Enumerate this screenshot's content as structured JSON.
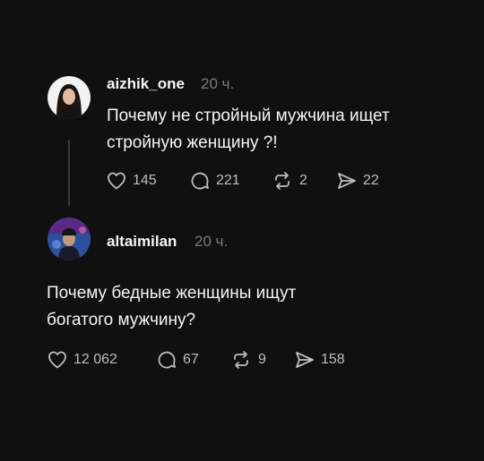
{
  "posts": [
    {
      "username": "aizhik_one",
      "time": "20 ч.",
      "text_lines": [
        "Почему не стройный мужчина ищет",
        "стройную женщину ?!"
      ],
      "actions": {
        "likes": "145",
        "comments": "221",
        "reposts": "2",
        "shares": "22"
      }
    },
    {
      "username": "altaimilan",
      "time": "20 ч.",
      "text_lines": [
        "Почему бедные женщины ищут",
        "богатого мужчину?"
      ],
      "actions": {
        "likes": "12 062",
        "comments": "67",
        "reposts": "9",
        "shares": "158"
      }
    }
  ],
  "icons": {
    "like": "heart-icon",
    "comment": "comment-icon",
    "repost": "repost-icon",
    "share": "share-icon"
  },
  "colors": {
    "background": "#101010",
    "text": "#f3f5f7",
    "muted": "#7a7a7a",
    "thread_line": "#3a3a3a"
  }
}
